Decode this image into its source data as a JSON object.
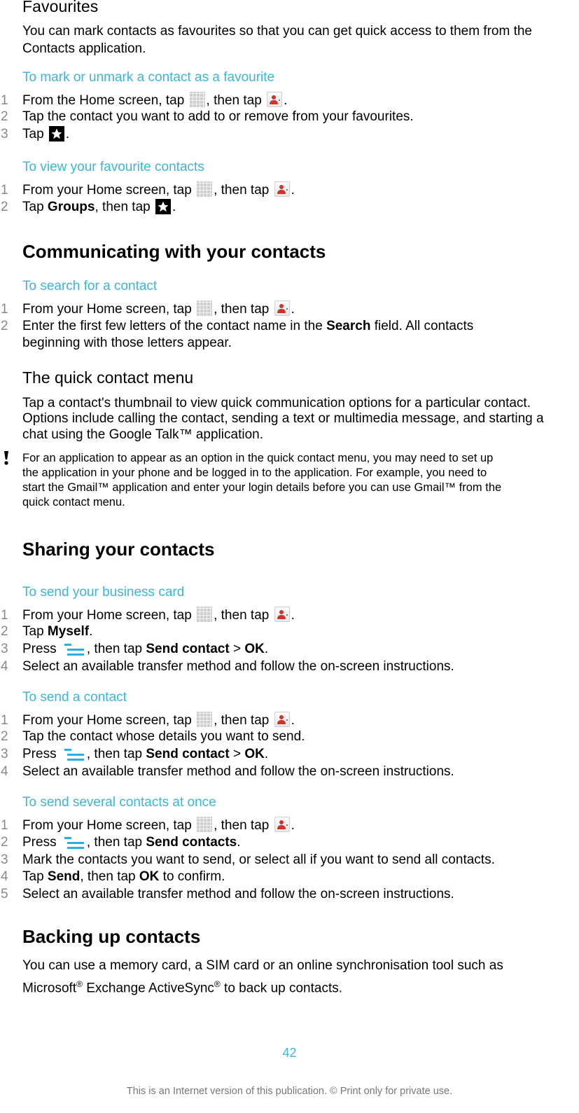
{
  "favourites": {
    "title": "Favourites",
    "intro": "You can mark contacts as favourites so that you can get quick access to them from the Contacts application.",
    "mark": {
      "heading": "To mark or unmark a contact as a favourite",
      "steps": [
        {
          "num": "1",
          "a": "From the Home screen, tap ",
          "b": ", then tap ",
          "c": "."
        },
        {
          "num": "2",
          "text": "Tap the contact you want to add to or remove from your favourites."
        },
        {
          "num": "3",
          "a": "Tap ",
          "c": "."
        }
      ]
    },
    "view": {
      "heading": "To view your favourite contacts",
      "steps": [
        {
          "num": "1",
          "a": "From your Home screen, tap ",
          "b": ", then tap ",
          "c": "."
        },
        {
          "num": "2",
          "a": "Tap ",
          "bold": "Groups",
          "b": ", then tap ",
          "c": "."
        }
      ]
    }
  },
  "communicating": {
    "title": "Communicating with your contacts",
    "search": {
      "heading": "To search for a contact",
      "steps": [
        {
          "num": "1",
          "a": "From your Home screen, tap ",
          "b": ", then tap ",
          "c": "."
        },
        {
          "num": "2",
          "a": "Enter the first few letters of the contact name in the ",
          "bold": "Search",
          "b": " field. All contacts",
          "line2": "beginning with those letters appear."
        }
      ]
    }
  },
  "quick_menu": {
    "title": "The quick contact menu",
    "para_lines": [
      "Tap a contact's thumbnail to view quick communication options for a particular contact.",
      "Options include calling the contact, sending a text or multimedia message, and starting a",
      "chat using the Google Talk™ application."
    ],
    "note_lines": [
      "For an application to appear as an option in the quick contact menu, you may need to set up",
      "the application in your phone and be logged in to the application. For example, you need to",
      "start the Gmail™ application and enter your login details before you can use Gmail™ from the",
      "quick contact menu."
    ]
  },
  "sharing": {
    "title": "Sharing your contacts",
    "business_card": {
      "heading": "To send your business card",
      "steps": [
        {
          "num": "1",
          "a": "From your Home screen, tap ",
          "b": ", then tap ",
          "c": "."
        },
        {
          "num": "2",
          "a": "Tap ",
          "bold": "Myself",
          "c": "."
        },
        {
          "num": "3",
          "a": "Press ",
          "b": ", then tap ",
          "bold": "Send contact",
          "gt": " > ",
          "bold2": "OK",
          "c": "."
        },
        {
          "num": "4",
          "text": "Select an available transfer method and follow the on-screen instructions."
        }
      ]
    },
    "send_contact": {
      "heading": "To send a contact",
      "steps": [
        {
          "num": "1",
          "a": "From your Home screen, tap ",
          "b": ", then tap ",
          "c": "."
        },
        {
          "num": "2",
          "text": "Tap the contact whose details you want to send."
        },
        {
          "num": "3",
          "a": "Press ",
          "b": ", then tap ",
          "bold": "Send contact",
          "gt": " > ",
          "bold2": "OK",
          "c": "."
        },
        {
          "num": "4",
          "text": "Select an available transfer method and follow the on-screen instructions."
        }
      ]
    },
    "send_several": {
      "heading": "To send several contacts at once",
      "steps": [
        {
          "num": "1",
          "a": "From your Home screen, tap ",
          "b": ", then tap ",
          "c": "."
        },
        {
          "num": "2",
          "a": "Press ",
          "b": ", then tap ",
          "bold": "Send contacts",
          "c": "."
        },
        {
          "num": "3",
          "text": "Mark the contacts you want to send, or select all if you want to send all contacts."
        },
        {
          "num": "4",
          "a": "Tap ",
          "bold": "Send",
          "b": ", then tap ",
          "bold2": "OK",
          "c": " to confirm."
        },
        {
          "num": "5",
          "text": "Select an available transfer method and follow the on-screen instructions."
        }
      ]
    }
  },
  "backup": {
    "title": "Backing up contacts",
    "line1": "You can use a memory card, a SIM card or an online synchronisation tool such as",
    "line2_a": "Microsoft",
    "reg": "®",
    "line2_b": " Exchange ActiveSync",
    "line2_c": " to back up contacts."
  },
  "icons": {
    "apps": "apps-grid-icon",
    "contacts": "contacts-app-icon",
    "favourite": "star-icon",
    "menu": "menu-icon",
    "warning": "exclamation-icon"
  },
  "colors": {
    "heading_blue": "#3ab6d9",
    "menu_icon": "#2ab0e0",
    "contact_red": "#d3312a"
  },
  "footer": {
    "page_number": "42",
    "notice": "This is an Internet version of this publication. © Print only for private use."
  }
}
